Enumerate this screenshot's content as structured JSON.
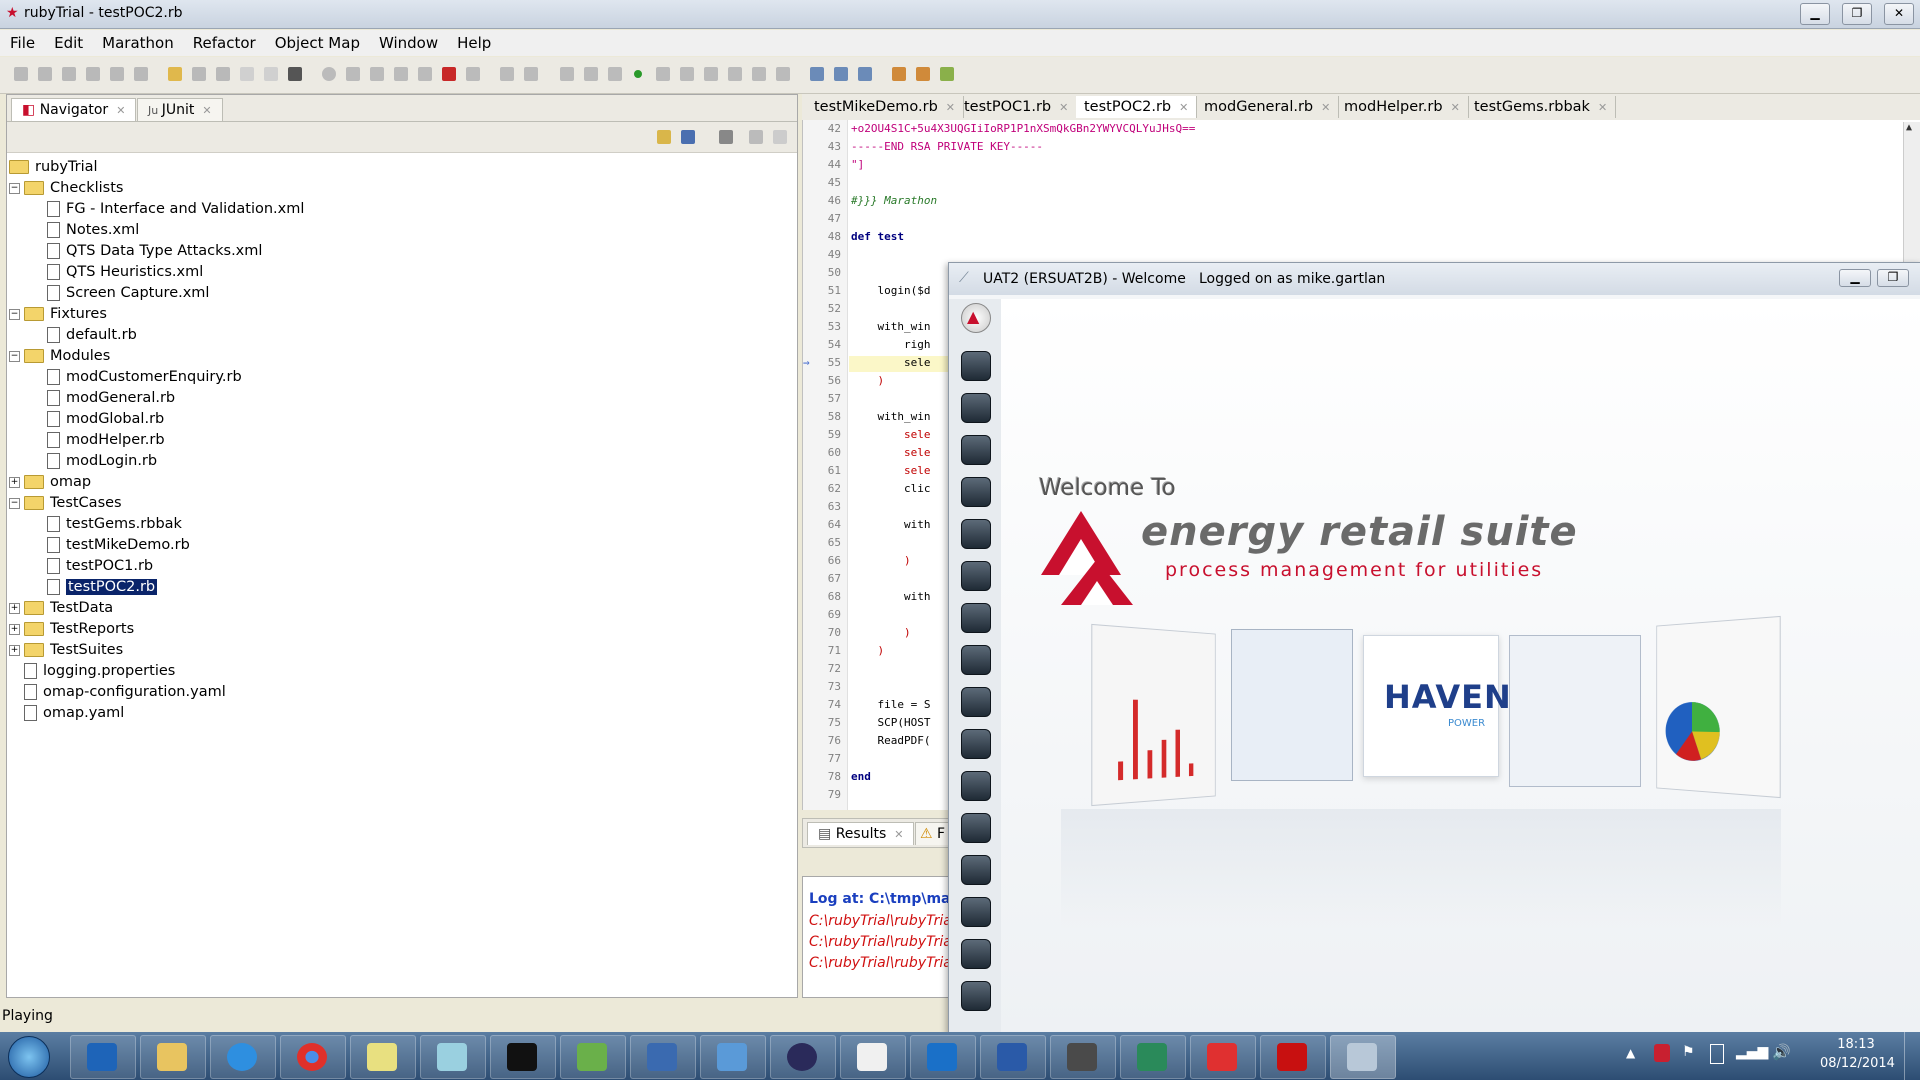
{
  "window": {
    "title": "rubyTrial - testPOC2.rb"
  },
  "menu": [
    "File",
    "Edit",
    "Marathon",
    "Refactor",
    "Object Map",
    "Window",
    "Help"
  ],
  "left_tabs": [
    "Navigator",
    "JUnit"
  ],
  "tree": [
    {
      "label": "rubyTrial",
      "type": "folder",
      "level": 0
    },
    {
      "label": "Checklists",
      "type": "folder",
      "level": 1,
      "exp": "-"
    },
    {
      "label": "FG - Interface and Validation.xml",
      "type": "file",
      "level": 2
    },
    {
      "label": "Notes.xml",
      "type": "file",
      "level": 2
    },
    {
      "label": "QTS Data Type Attacks.xml",
      "type": "file",
      "level": 2
    },
    {
      "label": "QTS Heuristics.xml",
      "type": "file",
      "level": 2
    },
    {
      "label": "Screen Capture.xml",
      "type": "file",
      "level": 2
    },
    {
      "label": "Fixtures",
      "type": "folder",
      "level": 1,
      "exp": "-"
    },
    {
      "label": "default.rb",
      "type": "file",
      "level": 2
    },
    {
      "label": "Modules",
      "type": "folder",
      "level": 1,
      "exp": "-"
    },
    {
      "label": "modCustomerEnquiry.rb",
      "type": "file",
      "level": 2
    },
    {
      "label": "modGeneral.rb",
      "type": "file",
      "level": 2
    },
    {
      "label": "modGlobal.rb",
      "type": "file",
      "level": 2
    },
    {
      "label": "modHelper.rb",
      "type": "file",
      "level": 2
    },
    {
      "label": "modLogin.rb",
      "type": "file",
      "level": 2
    },
    {
      "label": "omap",
      "type": "folder",
      "level": 1,
      "exp": "+"
    },
    {
      "label": "TestCases",
      "type": "folder",
      "level": 1,
      "exp": "-"
    },
    {
      "label": "testGems.rbbak",
      "type": "file",
      "level": 2
    },
    {
      "label": "testMikeDemo.rb",
      "type": "file",
      "level": 2
    },
    {
      "label": "testPOC1.rb",
      "type": "file",
      "level": 2
    },
    {
      "label": "testPOC2.rb",
      "type": "file",
      "level": 2,
      "selected": true
    },
    {
      "label": "TestData",
      "type": "folder",
      "level": 1,
      "exp": "+"
    },
    {
      "label": "TestReports",
      "type": "folder",
      "level": 1,
      "exp": "+"
    },
    {
      "label": "TestSuites",
      "type": "folder",
      "level": 1,
      "exp": "+"
    },
    {
      "label": "logging.properties",
      "type": "file",
      "level": 1
    },
    {
      "label": "omap-configuration.yaml",
      "type": "file",
      "level": 1
    },
    {
      "label": "omap.yaml",
      "type": "file",
      "level": 1
    }
  ],
  "editor_tabs": [
    "testMikeDemo.rb",
    "testPOC1.rb",
    "testPOC2.rb",
    "modGeneral.rb",
    "modHelper.rb",
    "testGems.rbbak"
  ],
  "code_lines": [
    {
      "n": "42",
      "t": "+o2OU4S1C+5u4X3UQGIiIoRP1P1nXSmQkGBn2YWYVCQLYuJHsQ==",
      "c": "#c0007a"
    },
    {
      "n": "43",
      "t": "-----END RSA PRIVATE KEY-----",
      "c": "#c0007a"
    },
    {
      "n": "44",
      "t": "\"]",
      "c": "#c0007a"
    },
    {
      "n": "45",
      "t": "",
      "c": "#000"
    },
    {
      "n": "46",
      "t": "#}}} Marathon",
      "c": "#2a7a2a"
    },
    {
      "n": "47",
      "t": "",
      "c": "#000"
    },
    {
      "n": "48",
      "t": "def test",
      "c": "#00007f"
    },
    {
      "n": "49",
      "t": "",
      "c": "#000"
    },
    {
      "n": "50",
      "t": "",
      "c": "#000"
    },
    {
      "n": "51",
      "t": "    login($d",
      "c": "#000"
    },
    {
      "n": "52",
      "t": "",
      "c": "#000"
    },
    {
      "n": "53",
      "t": "    with_win",
      "c": "#000"
    },
    {
      "n": "54",
      "t": "        righ",
      "c": "#000"
    },
    {
      "n": "55",
      "t": "        sele",
      "c": "#000"
    },
    {
      "n": "56",
      "t": "    )",
      "c": "#c00000"
    },
    {
      "n": "57",
      "t": "",
      "c": "#000"
    },
    {
      "n": "58",
      "t": "    with_win",
      "c": "#000"
    },
    {
      "n": "59",
      "t": "        sele",
      "c": "#c00000"
    },
    {
      "n": "60",
      "t": "        sele",
      "c": "#c00000"
    },
    {
      "n": "61",
      "t": "        sele",
      "c": "#c00000"
    },
    {
      "n": "62",
      "t": "        clic",
      "c": "#000"
    },
    {
      "n": "63",
      "t": "",
      "c": "#000"
    },
    {
      "n": "64",
      "t": "        with",
      "c": "#000"
    },
    {
      "n": "65",
      "t": "",
      "c": "#000"
    },
    {
      "n": "66",
      "t": "        )",
      "c": "#c00000"
    },
    {
      "n": "67",
      "t": "",
      "c": "#000"
    },
    {
      "n": "68",
      "t": "        with",
      "c": "#000"
    },
    {
      "n": "69",
      "t": "",
      "c": "#000"
    },
    {
      "n": "70",
      "t": "        )",
      "c": "#c00000"
    },
    {
      "n": "71",
      "t": "    )",
      "c": "#c00000"
    },
    {
      "n": "72",
      "t": "",
      "c": "#000"
    },
    {
      "n": "73",
      "t": "",
      "c": "#000"
    },
    {
      "n": "74",
      "t": "    file = S",
      "c": "#000"
    },
    {
      "n": "75",
      "t": "    SCP(HOST",
      "c": "#000"
    },
    {
      "n": "76",
      "t": "    ReadPDF(",
      "c": "#000"
    },
    {
      "n": "77",
      "t": "",
      "c": "#000"
    },
    {
      "n": "78",
      "t": "end",
      "c": "#00007f"
    },
    {
      "n": "79",
      "t": "",
      "c": "#000"
    }
  ],
  "results_tabs": [
    "Results",
    "F"
  ],
  "results": {
    "log": "Log at: C:\\tmp\\mara",
    "lines": [
      "C:\\rubyTrial\\rubyTrial",
      "C:\\rubyTrial\\rubyTrial",
      "C:\\rubyTrial\\rubyTrial"
    ]
  },
  "status": "Playing",
  "dialog": {
    "title": "UAT2 (ERSUAT2B) - Welcome",
    "user": "Logged on as mike.gartlan",
    "welcome": "Welcome To",
    "brand": "energy retail suite",
    "tagline": "process management for utilities",
    "haven": "HAVEN",
    "power": "POWER"
  },
  "tray": {
    "time": "18:13",
    "date": "08/12/2014"
  },
  "colors": {
    "brand_red": "#c8102e",
    "selection": "#0a246a"
  }
}
